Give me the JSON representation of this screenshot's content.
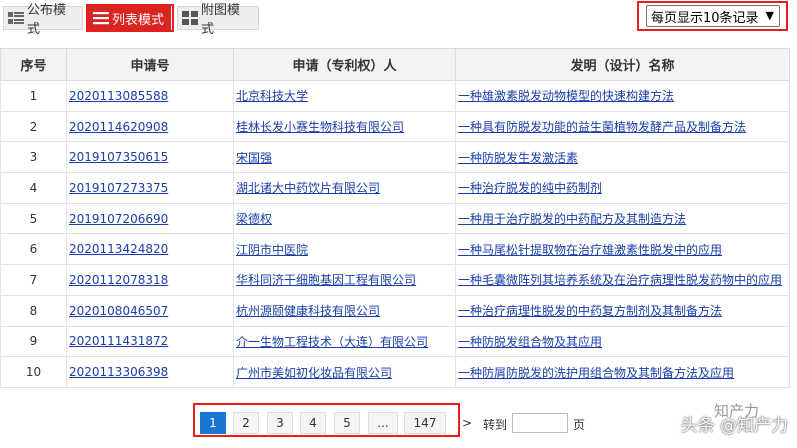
{
  "toolbar": {
    "modes": [
      {
        "label": "公布模式",
        "icon": "publish-mode-icon"
      },
      {
        "label": "列表模式",
        "icon": "list-mode-icon"
      },
      {
        "label": "附图模式",
        "icon": "grid-mode-icon"
      }
    ],
    "page_size": "每页显示10条记录",
    "accent_color": "#d9241f",
    "highlight_color": "#e41f1f"
  },
  "table": {
    "headers": [
      "序号",
      "申请号",
      "申请（专利权）人",
      "发明（设计）名称"
    ],
    "rows": [
      {
        "no": "1",
        "app_no": "2020113085588",
        "applicant": "北京科技大学",
        "title": "一种雄激素脱发动物模型的快速构建方法"
      },
      {
        "no": "2",
        "app_no": "2020114620908",
        "applicant": "桂林长发小赛生物科技有限公司",
        "title": "一种具有防脱发功能的益生菌植物发酵产品及制备方法"
      },
      {
        "no": "3",
        "app_no": "2019107350615",
        "applicant": "宋国强",
        "title": "一种防脱发生发激活素"
      },
      {
        "no": "4",
        "app_no": "2019107273375",
        "applicant": "湖北诸大中药饮片有限公司",
        "title": "一种治疗脱发的纯中药制剂"
      },
      {
        "no": "5",
        "app_no": "2019107206690",
        "applicant": "梁德权",
        "title": "一种用于治疗脱发的中药配方及其制造方法"
      },
      {
        "no": "6",
        "app_no": "2020113424820",
        "applicant": "江阴市中医院",
        "title": "一种马尾松针提取物在治疗雄激素性脱发中的应用"
      },
      {
        "no": "7",
        "app_no": "2020112078318",
        "applicant": "华科同济干细胞基因工程有限公司",
        "title": "一种毛囊微阵列其培养系统及在治疗病理性脱发药物中的应用"
      },
      {
        "no": "8",
        "app_no": "2020108046507",
        "applicant": "杭州源颐健康科技有限公司",
        "title": "一种治疗病理性脱发的中药复方制剂及其制备方法"
      },
      {
        "no": "9",
        "app_no": "2020111431872",
        "applicant": "介一生物工程技术（大连）有限公司",
        "title": "一种防脱发组合物及其应用"
      },
      {
        "no": "10",
        "app_no": "2020113306398",
        "applicant": "广州市美如初化妆品有限公司",
        "title": "一种防屑防脱发的洗护用组合物及其制备方法及应用"
      }
    ],
    "link_color": "#1a3ea8"
  },
  "pager": {
    "pages": [
      "1",
      "2",
      "3",
      "4",
      "5",
      "...",
      "147"
    ],
    "current": "1",
    "next": ">",
    "goto_label": "转到",
    "goto_value": "",
    "page_unit": "页",
    "current_color": "#1976d2"
  },
  "watermark": {
    "text": "头条 @知产力",
    "logo_text": "知产力"
  }
}
